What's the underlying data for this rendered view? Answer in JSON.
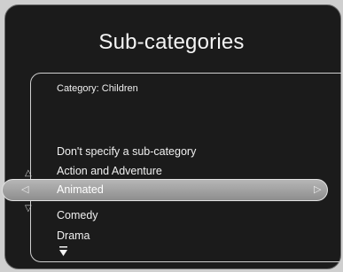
{
  "header": {
    "title": "Sub-categories"
  },
  "panel": {
    "category_label": "Category: Children",
    "items": [
      {
        "label": "Don't specify a sub-category"
      },
      {
        "label": "Action and Adventure"
      },
      {
        "label": "Animated",
        "selected": true
      },
      {
        "label": "Comedy"
      },
      {
        "label": "Drama"
      }
    ]
  },
  "icons": {
    "scroll_up": "arrow-up-icon",
    "scroll_down": "arrow-down-icon",
    "select_left": "chevron-left-icon",
    "select_right": "chevron-right-icon",
    "more_below": "more-below-icon"
  },
  "colors": {
    "background": "#1b1b1b",
    "text": "#f0f0f0",
    "selection": "#a6a6a6"
  }
}
